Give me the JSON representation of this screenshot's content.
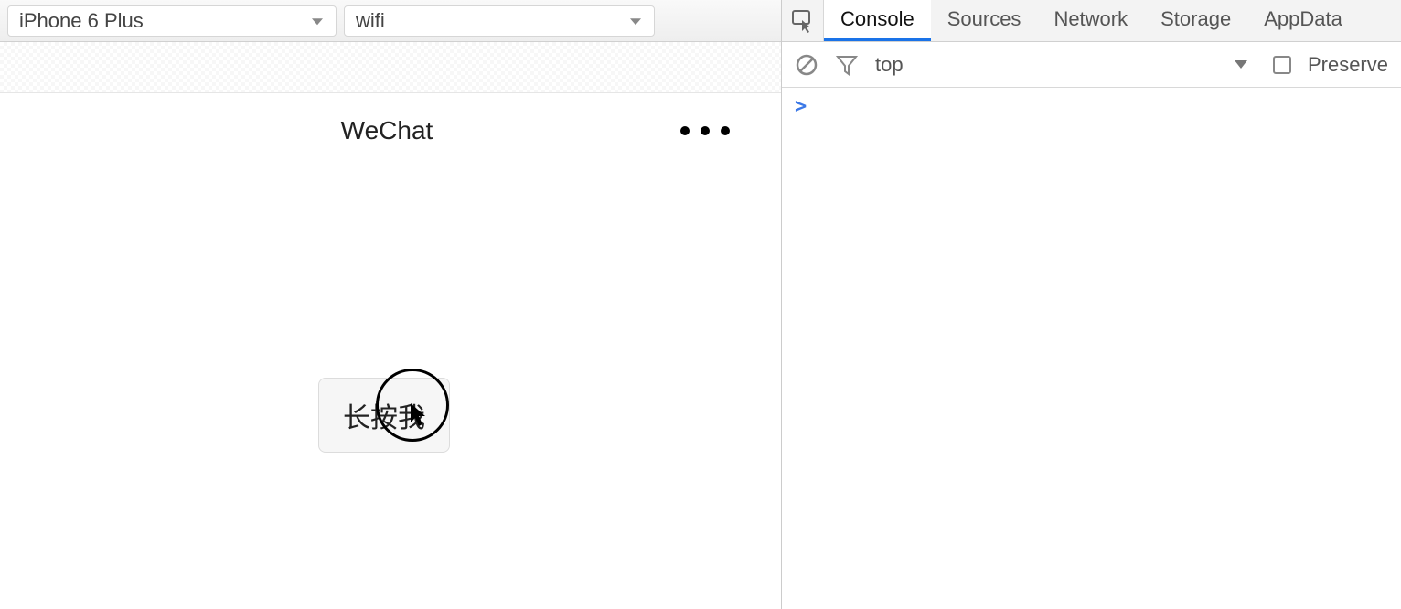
{
  "simulator": {
    "device_dropdown": "iPhone 6 Plus",
    "network_dropdown": "wifi",
    "nav_title": "WeChat",
    "long_press_button_label": "长按我"
  },
  "devtools": {
    "tabs": {
      "console": "Console",
      "sources": "Sources",
      "network": "Network",
      "storage": "Storage",
      "appdata": "AppData"
    },
    "context_selector": "top",
    "preserve_log_label": "Preserve",
    "console_prompt": ">"
  }
}
